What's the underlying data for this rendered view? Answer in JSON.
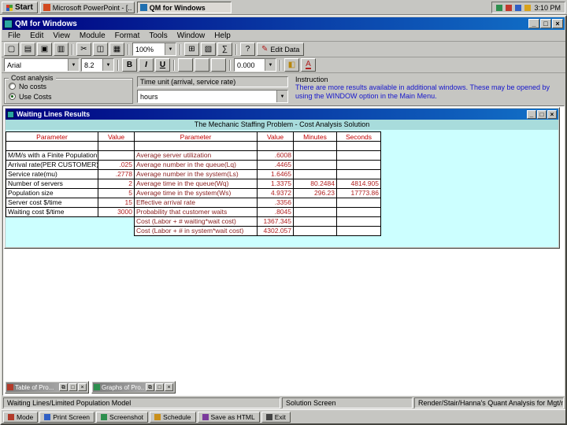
{
  "taskbar": {
    "start_label": "Start",
    "tasks": [
      {
        "label": "Microsoft PowerPoint - [...",
        "active": false
      },
      {
        "label": "QM for Windows",
        "active": true
      }
    ],
    "clock": "3:10 PM"
  },
  "window": {
    "title": "QM for Windows",
    "menus": [
      "File",
      "Edit",
      "View",
      "Module",
      "Format",
      "Tools",
      "Window",
      "Help"
    ]
  },
  "toolbar": {
    "zoom": "100%",
    "edit_data_label": "Edit Data"
  },
  "format_bar": {
    "font": "Arial",
    "size": "8.2",
    "decimals": "0.000"
  },
  "panels": {
    "cost_analysis": {
      "label": "Cost analysis",
      "options": [
        {
          "label": "No costs",
          "selected": false
        },
        {
          "label": "Use Costs",
          "selected": true
        }
      ]
    },
    "time_unit": {
      "label": "Time unit (arrival, service rate)",
      "value": "hours"
    },
    "instruction": {
      "label": "Instruction",
      "text": "There are more results available in additional windows. These may be opened by using the WINDOW option in the Main Menu."
    }
  },
  "results_window": {
    "title": "Waiting Lines Results",
    "header": "The Mechanic Staffing Problem - Cost Analysis Solution",
    "columns": [
      "Parameter",
      "Value",
      "Parameter",
      "Value",
      "Minutes",
      "Seconds"
    ],
    "left_rows": [
      {
        "parameter": "M/M/s with a Finite Population",
        "value": ""
      },
      {
        "parameter": "Arrival rate(PER CUSTOMER)",
        "value": ".025"
      },
      {
        "parameter": "Service rate(mu)",
        "value": ".2778"
      },
      {
        "parameter": "Number of servers",
        "value": "2"
      },
      {
        "parameter": "Population size",
        "value": "5"
      },
      {
        "parameter": "Server cost $/time",
        "value": "15"
      },
      {
        "parameter": "Waiting cost $/time",
        "value": "3000"
      }
    ],
    "right_rows": [
      {
        "parameter": "Average server utilization",
        "value": ".6008",
        "minutes": "",
        "seconds": ""
      },
      {
        "parameter": "Average number in the queue(Lq)",
        "value": ".4465",
        "minutes": "",
        "seconds": ""
      },
      {
        "parameter": "Average number in the system(Ls)",
        "value": "1.6465",
        "minutes": "",
        "seconds": ""
      },
      {
        "parameter": "Average time in the queue(Wq)",
        "value": "1.3375",
        "minutes": "80.2484",
        "seconds": "4814.905"
      },
      {
        "parameter": "Average time in the system(Ws)",
        "value": "4.9372",
        "minutes": "296.23",
        "seconds": "17773.86"
      },
      {
        "parameter": "Effective arrival rate",
        "value": ".3356",
        "minutes": "",
        "seconds": ""
      },
      {
        "parameter": "Probability that customer waits",
        "value": ".8045",
        "minutes": "",
        "seconds": ""
      },
      {
        "parameter": "Cost (Labor + # waiting*wait cost)",
        "value": "1367.345",
        "minutes": "",
        "seconds": ""
      },
      {
        "parameter": "Cost (Labor + # in system*wait cost)",
        "value": "4302.057",
        "minutes": "",
        "seconds": ""
      }
    ]
  },
  "minimized_windows": [
    {
      "title": "Table of Pro..."
    },
    {
      "title": "Graphs of Pro..."
    }
  ],
  "status_bar": {
    "model": "Waiting Lines/Limited Population Model",
    "screen": "Solution Screen",
    "book": "Render/Stair/Hanna's Quant Analysis for Mgt/me"
  },
  "bottom_toolbar": {
    "buttons": [
      "Mode",
      "Print Screen",
      "Screenshot",
      "Schedule",
      "Save as HTML",
      "Exit"
    ]
  },
  "icons": {
    "new": "▢",
    "open": "▤",
    "save": "▣",
    "print": "▥",
    "cut": "✂",
    "copy": "◫",
    "paste": "▦",
    "table": "⊞",
    "chart": "▧",
    "sum": "∑",
    "help": "?",
    "edit": "✎",
    "dropdown": "▼",
    "bold": "B",
    "italic": "I",
    "underline": "U",
    "align": "≡",
    "fill": "◧",
    "font_color": "A",
    "minimize": "_",
    "maximize": "□",
    "close": "×",
    "restore": "⧉"
  }
}
